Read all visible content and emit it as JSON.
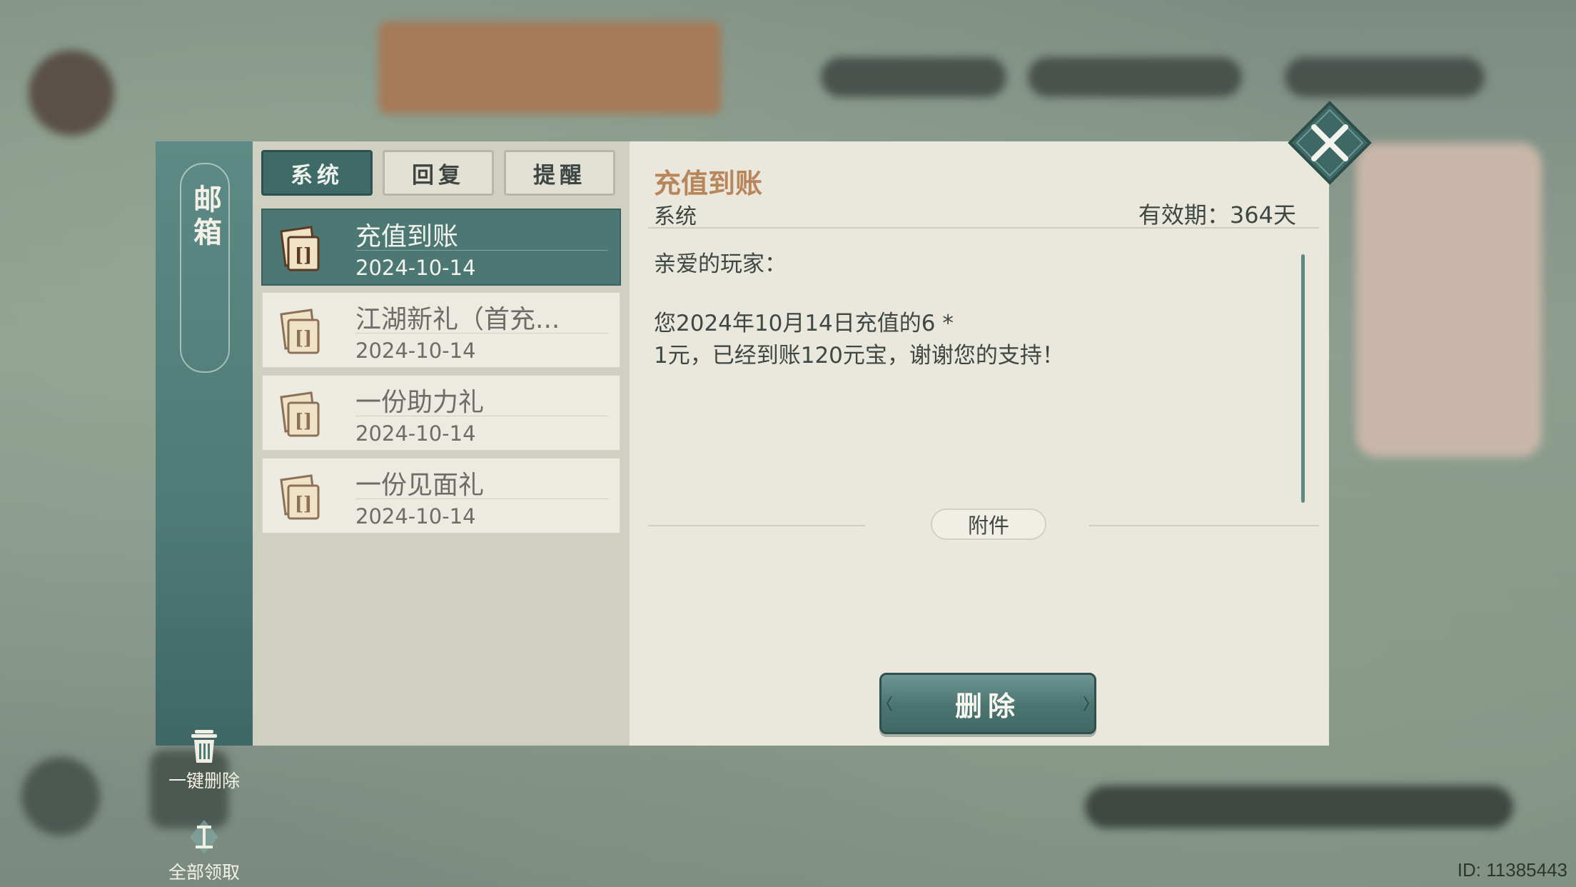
{
  "rail": {
    "title": "邮箱",
    "delete_all_label": "一键删除",
    "claim_all_label": "全部领取"
  },
  "tabs": [
    {
      "label": "系统",
      "active": true
    },
    {
      "label": "回复",
      "active": false
    },
    {
      "label": "提醒",
      "active": false
    }
  ],
  "mails": [
    {
      "subject": "充值到账",
      "date": "2024-10-14",
      "selected": true
    },
    {
      "subject": "江湖新礼（首充...",
      "date": "2024-10-14",
      "selected": false
    },
    {
      "subject": "一份助力礼",
      "date": "2024-10-14",
      "selected": false
    },
    {
      "subject": "一份见面礼",
      "date": "2024-10-14",
      "selected": false
    }
  ],
  "detail": {
    "title": "充值到账",
    "sender": "系统",
    "validity": "有效期：364天",
    "greeting": "亲爱的玩家：",
    "body_line1": "您2024年10月14日充值的6 *",
    "body_line2": "1元，已经到账120元宝，谢谢您的支持！",
    "attachment_label": "附件",
    "delete_button": "删除"
  },
  "watermark": "ID: 11385443",
  "colors": {
    "accent_teal": "#4d7773",
    "title_orange": "#b9855a",
    "panel_bg": "#eae8dc"
  },
  "icons": {
    "close": "close-x-icon",
    "trash": "trash-icon",
    "claim": "claim-icon",
    "envelope": "envelope-icon"
  }
}
